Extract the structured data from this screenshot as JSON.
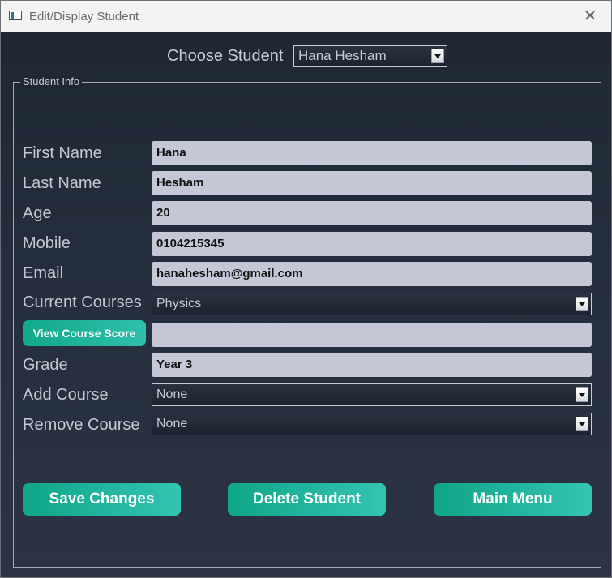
{
  "window": {
    "title": "Edit/Display Student"
  },
  "chooser": {
    "label": "Choose Student",
    "selected": "Hana Hesham"
  },
  "group": {
    "title": "Student Info"
  },
  "fields": {
    "first_name": {
      "label": "First Name",
      "value": "Hana"
    },
    "last_name": {
      "label": "Last Name",
      "value": "Hesham"
    },
    "age": {
      "label": "Age",
      "value": "20"
    },
    "mobile": {
      "label": "Mobile",
      "value": "0104215345"
    },
    "email": {
      "label": "Email",
      "value": "hanahesham@gmail.com"
    },
    "current_courses": {
      "label": "Current Courses",
      "selected": "Physics"
    },
    "course_score": {
      "button_label": "View Course Score",
      "value": ""
    },
    "grade": {
      "label": "Grade",
      "value": "Year 3"
    },
    "add_course": {
      "label": "Add Course",
      "selected": "None"
    },
    "remove_course": {
      "label": "Remove Course",
      "selected": "None"
    }
  },
  "actions": {
    "save": "Save Changes",
    "delete": "Delete Student",
    "main_menu": "Main Menu"
  },
  "colors": {
    "background": "#202733",
    "input_background": "#c3c7d6",
    "accent_start": "#0fa587",
    "accent_end": "#34c4b3"
  }
}
